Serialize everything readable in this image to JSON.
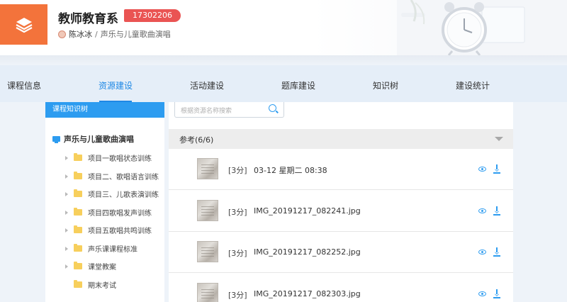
{
  "header": {
    "title": "教师教育系",
    "badge": "17302206",
    "user": "陈冰冰",
    "separator": "/",
    "course": "声乐与儿童歌曲演唱"
  },
  "nav": {
    "items": [
      {
        "label": "课程信息"
      },
      {
        "label": "资源建设"
      },
      {
        "label": "活动建设"
      },
      {
        "label": "题库建设"
      },
      {
        "label": "知识树"
      },
      {
        "label": "建设统计"
      }
    ],
    "active": "资源建设"
  },
  "tree": {
    "header": "课程知识树",
    "root": "声乐与儿童歌曲演唱",
    "items": [
      {
        "label": "项目一歌唱状态训练"
      },
      {
        "label": "项目二、歌唱语言训练"
      },
      {
        "label": "项目三、儿歌表演训练"
      },
      {
        "label": "项目四歌唱发声训练"
      },
      {
        "label": "项目五歌唱共鸣训练"
      },
      {
        "label": "声乐课课程标准"
      },
      {
        "label": "课堂教案"
      },
      {
        "label": "期末考试"
      }
    ]
  },
  "search": {
    "placeholder": "根据资源名称搜索"
  },
  "section": {
    "title": "参考(6/6)"
  },
  "files": [
    {
      "score": "[3分]",
      "name": "03-12 星期二 08:38"
    },
    {
      "score": "[3分]",
      "name": "IMG_20191217_082241.jpg"
    },
    {
      "score": "[3分]",
      "name": "IMG_20191217_082252.jpg"
    },
    {
      "score": "[3分]",
      "name": "IMG_20191217_082303.jpg"
    }
  ],
  "colors": {
    "accent": "#1e88e5",
    "logo": "#f3733b",
    "badge": "#ea5453",
    "tree_header": "#2d9cf0"
  },
  "icons": {
    "logo": "layers-icon",
    "search": "search-icon",
    "preview": "eye-icon",
    "download": "download-icon"
  }
}
